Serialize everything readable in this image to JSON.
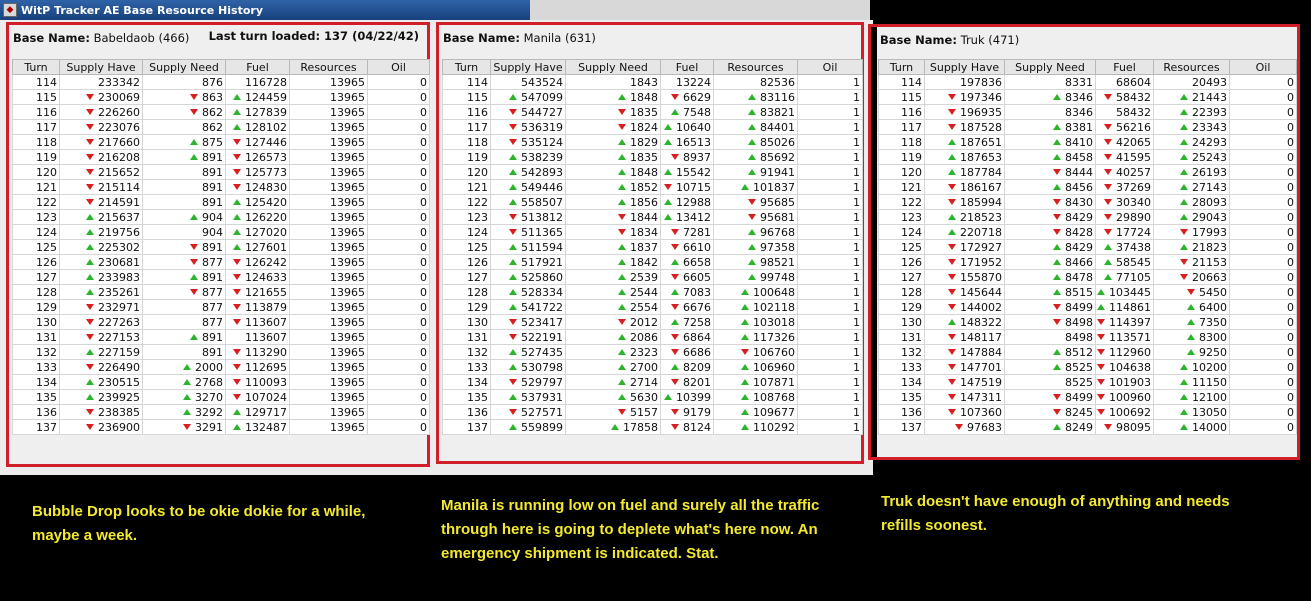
{
  "window_title": "WitP Tracker AE Base Resource History",
  "columns": [
    "Turn",
    "Supply Have",
    "Supply Need",
    "Fuel",
    "Resources",
    "Oil"
  ],
  "panels": [
    {
      "base_label": "Base Name:",
      "base_name": "Babeldaob (466)",
      "last_turn": "Last turn loaded: 137 (04/22/42)",
      "rows": [
        [
          114,
          233342,
          "",
          876,
          "",
          116728,
          "",
          13965,
          "",
          0,
          ""
        ],
        [
          115,
          230069,
          "down",
          863,
          "down",
          124459,
          "up",
          13965,
          "",
          0,
          ""
        ],
        [
          116,
          226260,
          "down",
          862,
          "down",
          127839,
          "up",
          13965,
          "",
          0,
          ""
        ],
        [
          117,
          223076,
          "down",
          862,
          "",
          128102,
          "up",
          13965,
          "",
          0,
          ""
        ],
        [
          118,
          217660,
          "down",
          875,
          "up",
          127446,
          "down",
          13965,
          "",
          0,
          ""
        ],
        [
          119,
          216208,
          "down",
          891,
          "up",
          126573,
          "down",
          13965,
          "",
          0,
          ""
        ],
        [
          120,
          215652,
          "down",
          891,
          "",
          125773,
          "down",
          13965,
          "",
          0,
          ""
        ],
        [
          121,
          215114,
          "down",
          891,
          "",
          124830,
          "down",
          13965,
          "",
          0,
          ""
        ],
        [
          122,
          214591,
          "down",
          891,
          "",
          125420,
          "up",
          13965,
          "",
          0,
          ""
        ],
        [
          123,
          215637,
          "up",
          904,
          "up",
          126220,
          "up",
          13965,
          "",
          0,
          ""
        ],
        [
          124,
          219756,
          "up",
          904,
          "",
          127020,
          "up",
          13965,
          "",
          0,
          ""
        ],
        [
          125,
          225302,
          "up",
          891,
          "down",
          127601,
          "up",
          13965,
          "",
          0,
          ""
        ],
        [
          126,
          230681,
          "up",
          877,
          "down",
          126242,
          "down",
          13965,
          "",
          0,
          ""
        ],
        [
          127,
          233983,
          "up",
          891,
          "up",
          124633,
          "down",
          13965,
          "",
          0,
          ""
        ],
        [
          128,
          235261,
          "up",
          877,
          "down",
          121655,
          "down",
          13965,
          "",
          0,
          ""
        ],
        [
          129,
          232971,
          "down",
          877,
          "",
          113879,
          "down",
          13965,
          "",
          0,
          ""
        ],
        [
          130,
          227263,
          "down",
          877,
          "",
          113607,
          "down",
          13965,
          "",
          0,
          ""
        ],
        [
          131,
          227153,
          "down",
          891,
          "up",
          113607,
          "",
          13965,
          "",
          0,
          ""
        ],
        [
          132,
          227159,
          "up",
          891,
          "",
          113290,
          "down",
          13965,
          "",
          0,
          ""
        ],
        [
          133,
          226490,
          "down",
          2000,
          "up",
          112695,
          "down",
          13965,
          "",
          0,
          ""
        ],
        [
          134,
          230515,
          "up",
          2768,
          "up",
          110093,
          "down",
          13965,
          "",
          0,
          ""
        ],
        [
          135,
          239925,
          "up",
          3270,
          "up",
          107024,
          "down",
          13965,
          "",
          0,
          ""
        ],
        [
          136,
          238385,
          "down",
          3292,
          "up",
          129717,
          "up",
          13965,
          "",
          0,
          ""
        ],
        [
          137,
          236900,
          "down",
          3291,
          "down",
          132487,
          "up",
          13965,
          "",
          0,
          ""
        ]
      ]
    },
    {
      "base_label": "Base Name:",
      "base_name": "Manila (631)",
      "last_turn": "",
      "rows": [
        [
          114,
          543524,
          "",
          1843,
          "",
          13224,
          "",
          82536,
          "",
          1,
          ""
        ],
        [
          115,
          547099,
          "up",
          1848,
          "up",
          6629,
          "down",
          83116,
          "up",
          1,
          ""
        ],
        [
          116,
          544727,
          "down",
          1835,
          "down",
          7548,
          "up",
          83821,
          "up",
          1,
          ""
        ],
        [
          117,
          536319,
          "down",
          1824,
          "down",
          10640,
          "up",
          84401,
          "up",
          1,
          ""
        ],
        [
          118,
          535124,
          "down",
          1829,
          "up",
          16513,
          "up",
          85026,
          "up",
          1,
          ""
        ],
        [
          119,
          538239,
          "up",
          1835,
          "up",
          8937,
          "down",
          85692,
          "up",
          1,
          ""
        ],
        [
          120,
          542893,
          "up",
          1848,
          "up",
          15542,
          "up",
          91941,
          "up",
          1,
          ""
        ],
        [
          121,
          549446,
          "up",
          1852,
          "up",
          10715,
          "down",
          101837,
          "up",
          1,
          ""
        ],
        [
          122,
          558507,
          "up",
          1856,
          "up",
          12988,
          "up",
          95685,
          "down",
          1,
          ""
        ],
        [
          123,
          513812,
          "down",
          1844,
          "down",
          13412,
          "up",
          95681,
          "down",
          1,
          ""
        ],
        [
          124,
          511365,
          "down",
          1834,
          "down",
          7281,
          "down",
          96768,
          "up",
          1,
          ""
        ],
        [
          125,
          511594,
          "up",
          1837,
          "up",
          6610,
          "down",
          97358,
          "up",
          1,
          ""
        ],
        [
          126,
          517921,
          "up",
          1842,
          "up",
          6658,
          "up",
          98521,
          "up",
          1,
          ""
        ],
        [
          127,
          525860,
          "up",
          2539,
          "up",
          6605,
          "down",
          99748,
          "up",
          1,
          ""
        ],
        [
          128,
          528334,
          "up",
          2544,
          "up",
          7083,
          "up",
          100648,
          "up",
          1,
          ""
        ],
        [
          129,
          541722,
          "up",
          2554,
          "up",
          6676,
          "down",
          102118,
          "up",
          1,
          ""
        ],
        [
          130,
          523417,
          "down",
          2012,
          "down",
          7258,
          "up",
          103018,
          "up",
          1,
          ""
        ],
        [
          131,
          522191,
          "down",
          2086,
          "up",
          6864,
          "down",
          117326,
          "up",
          1,
          ""
        ],
        [
          132,
          527435,
          "up",
          2323,
          "up",
          6686,
          "down",
          106760,
          "down",
          1,
          ""
        ],
        [
          133,
          530798,
          "up",
          2700,
          "up",
          8209,
          "up",
          106960,
          "up",
          1,
          ""
        ],
        [
          134,
          529797,
          "down",
          2714,
          "up",
          8201,
          "down",
          107871,
          "up",
          1,
          ""
        ],
        [
          135,
          537931,
          "up",
          5630,
          "up",
          10399,
          "up",
          108768,
          "up",
          1,
          ""
        ],
        [
          136,
          527571,
          "down",
          5157,
          "down",
          9179,
          "down",
          109677,
          "up",
          1,
          ""
        ],
        [
          137,
          559899,
          "up",
          17858,
          "up",
          8124,
          "down",
          110292,
          "up",
          1,
          ""
        ]
      ]
    },
    {
      "base_label": "Base Name:",
      "base_name": "Truk (471)",
      "last_turn": "",
      "rows": [
        [
          114,
          197836,
          "",
          8331,
          "",
          68604,
          "",
          20493,
          "",
          0,
          ""
        ],
        [
          115,
          197346,
          "down",
          8346,
          "up",
          58432,
          "down",
          21443,
          "up",
          0,
          ""
        ],
        [
          116,
          196935,
          "down",
          8346,
          "",
          58432,
          "",
          22393,
          "up",
          0,
          ""
        ],
        [
          117,
          187528,
          "down",
          8381,
          "up",
          56216,
          "down",
          23343,
          "up",
          0,
          ""
        ],
        [
          118,
          187651,
          "up",
          8410,
          "up",
          42065,
          "down",
          24293,
          "up",
          0,
          ""
        ],
        [
          119,
          187653,
          "up",
          8458,
          "up",
          41595,
          "down",
          25243,
          "up",
          0,
          ""
        ],
        [
          120,
          187784,
          "up",
          8444,
          "down",
          40257,
          "down",
          26193,
          "up",
          0,
          ""
        ],
        [
          121,
          186167,
          "down",
          8456,
          "up",
          37269,
          "down",
          27143,
          "up",
          0,
          ""
        ],
        [
          122,
          185994,
          "down",
          8430,
          "down",
          30340,
          "down",
          28093,
          "up",
          0,
          ""
        ],
        [
          123,
          218523,
          "up",
          8429,
          "down",
          29890,
          "down",
          29043,
          "up",
          0,
          ""
        ],
        [
          124,
          220718,
          "up",
          8428,
          "down",
          17724,
          "down",
          17993,
          "down",
          0,
          ""
        ],
        [
          125,
          172927,
          "down",
          8429,
          "up",
          37438,
          "up",
          21823,
          "up",
          0,
          ""
        ],
        [
          126,
          171952,
          "down",
          8466,
          "up",
          58545,
          "up",
          21153,
          "down",
          0,
          ""
        ],
        [
          127,
          155870,
          "down",
          8478,
          "up",
          77105,
          "up",
          20663,
          "down",
          0,
          ""
        ],
        [
          128,
          145644,
          "down",
          8515,
          "up",
          103445,
          "up",
          5450,
          "down",
          0,
          ""
        ],
        [
          129,
          144002,
          "down",
          8499,
          "down",
          114861,
          "up",
          6400,
          "up",
          0,
          ""
        ],
        [
          130,
          148322,
          "up",
          8498,
          "down",
          114397,
          "down",
          7350,
          "up",
          0,
          ""
        ],
        [
          131,
          148117,
          "down",
          8498,
          "",
          113571,
          "down",
          8300,
          "up",
          0,
          ""
        ],
        [
          132,
          147884,
          "down",
          8512,
          "up",
          112960,
          "down",
          9250,
          "up",
          0,
          ""
        ],
        [
          133,
          147701,
          "down",
          8525,
          "up",
          104638,
          "down",
          10200,
          "up",
          0,
          ""
        ],
        [
          134,
          147519,
          "down",
          8525,
          "",
          101903,
          "down",
          11150,
          "up",
          0,
          ""
        ],
        [
          135,
          147311,
          "down",
          8499,
          "down",
          100960,
          "down",
          12100,
          "up",
          0,
          ""
        ],
        [
          136,
          107360,
          "down",
          8245,
          "down",
          100692,
          "down",
          13050,
          "up",
          0,
          ""
        ],
        [
          137,
          97683,
          "down",
          8249,
          "up",
          98095,
          "down",
          14000,
          "up",
          0,
          ""
        ]
      ]
    }
  ],
  "captions": [
    "Bubble Drop looks to be okie dokie for a while, maybe a week.",
    "Manila is running low on fuel and surely all the traffic through here is going to deplete what's here now.  An emergency shipment is indicated.  Stat.",
    "Truk doesn't have enough of anything and needs refills soonest."
  ],
  "colors": {
    "highlight_border": "#d11f2a",
    "arrow_up": "#2cb52c",
    "arrow_down": "#d81f1f",
    "caption_text": "#f3e92f"
  }
}
